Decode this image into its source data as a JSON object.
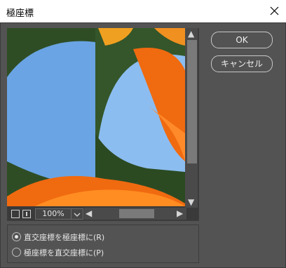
{
  "window": {
    "title": "極座標"
  },
  "preview": {
    "zoom_value": "100%"
  },
  "buttons": {
    "ok": "OK",
    "cancel": "キャンセル"
  },
  "options": [
    {
      "label": "直交座標を極座標に(R)",
      "selected": true
    },
    {
      "label": "極座標を直交座標に(P)",
      "selected": false
    }
  ],
  "icons": {
    "close": "close-icon",
    "scroll_up": "arrow-up-icon",
    "scroll_down": "arrow-down-icon",
    "scroll_left": "arrow-left-icon",
    "scroll_right": "arrow-right-icon"
  },
  "colors": {
    "background": "#535353",
    "titlebar": "#ffffff",
    "accent_flower": "#f06a10",
    "sky": "#6aa5e6"
  }
}
